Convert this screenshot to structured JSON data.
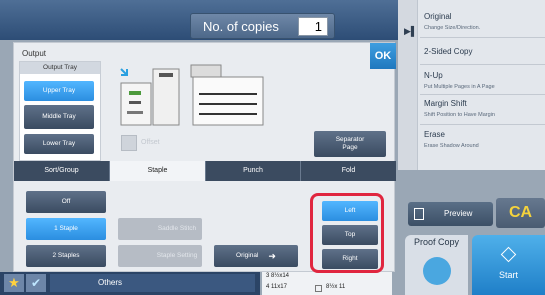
{
  "copies": {
    "label": "No. of copies",
    "value": "1"
  },
  "functions": [
    {
      "title": "Original",
      "subtitle": "Change Size/Direction."
    },
    {
      "title": "2-Sided Copy",
      "subtitle": ""
    },
    {
      "title": "N-Up",
      "subtitle": "Put Multiple Pages in A Page"
    },
    {
      "title": "Margin Shift",
      "subtitle": "Shift Position to Have Margin"
    },
    {
      "title": "Erase",
      "subtitle": "Erase Shadow Around"
    }
  ],
  "preview_label": "Preview",
  "ca_label": "CA",
  "proof_copy_label": "Proof Copy",
  "start_label": "Start",
  "others_label": "Others",
  "paper_rows": [
    "3   8½x14",
    "4   11x17",
    "8½x 11"
  ],
  "dialog": {
    "title": "Output",
    "ok_label": "OK",
    "tray_header": "Output Tray",
    "upper_tray": "Upper Tray",
    "middle_tray": "Middle Tray",
    "lower_tray": "Lower Tray",
    "offset": "Offset",
    "separator_page": "Separator Page",
    "tabs": [
      "Sort/Group",
      "Staple",
      "Punch",
      "Fold"
    ],
    "staple": {
      "off": "Off",
      "one_staple": "1 Staple",
      "two_staples": "2 Staples",
      "saddle_stitch": "Saddle Stitch",
      "staple_setting": "Staple Setting",
      "original": "Original",
      "positions": [
        "Left",
        "Top",
        "Right"
      ]
    }
  },
  "colors": {
    "selected": "#3aa2f2",
    "highlight": "#e0263f",
    "accent": "#1f7fc8"
  }
}
